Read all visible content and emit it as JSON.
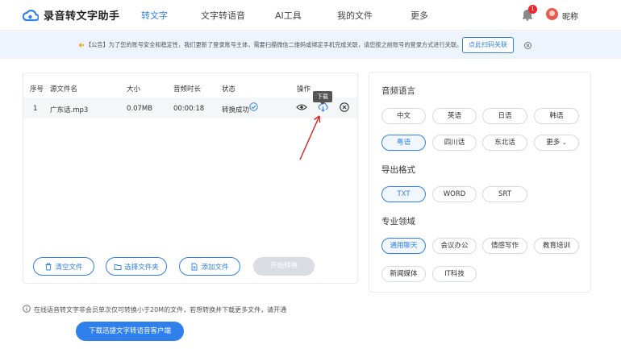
{
  "app": {
    "title": "录音转文字助手"
  },
  "nav": {
    "items": [
      "转文字",
      "文字转语音",
      "AI工具",
      "我的文件",
      "更多"
    ],
    "active_index": 0
  },
  "user": {
    "nickname": "昵称",
    "notification_count": "1"
  },
  "notice": {
    "text": "【公告】为了您的账号安全和稳定性，我们更新了登录账号主体，需要扫描微信二维码或绑定手机完成关联，请您按之前账号的登录方式进行关联。",
    "button_label": "点此扫码关联"
  },
  "file_table": {
    "columns": [
      "序号",
      "源文件名",
      "大小",
      "音频时长",
      "状态",
      "操作"
    ],
    "rows": [
      {
        "index": "1",
        "name": "广东话.mp3",
        "size": "0.07MB",
        "duration": "00:00:18",
        "status": "转换成功"
      }
    ],
    "tooltip": "下载"
  },
  "actions": {
    "clear": "清空文件",
    "select_folder": "选择文件夹",
    "add_file": "添加文件",
    "start": "开始转换"
  },
  "settings": {
    "language": {
      "title": "音频语言",
      "options": [
        "中文",
        "英语",
        "日语",
        "韩语",
        "粤语",
        "四川话",
        "东北话",
        "更多"
      ],
      "selected": "粤语"
    },
    "export_format": {
      "title": "导出格式",
      "options": [
        "TXT",
        "WORD",
        "SRT"
      ],
      "selected": "TXT"
    },
    "domain": {
      "title": "专业领域",
      "options": [
        "通用聊天",
        "会议办公",
        "情感写作",
        "教育培训",
        "新闻媒体",
        "IT科技"
      ],
      "selected": "通用聊天"
    }
  },
  "footer": {
    "info": "在线语音转文字非会员单次仅可转换小于20M的文件，若想转换并下载更多文件，请开通",
    "download_client": "下载迅捷文字转语音客户端"
  },
  "colors": {
    "accent": "#2f80ed",
    "notice_bg": "#eef4fc",
    "success": "#2f80ed",
    "arrow": "#e02020"
  }
}
